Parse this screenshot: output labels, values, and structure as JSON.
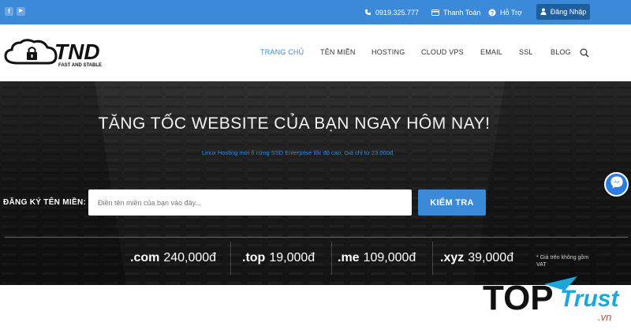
{
  "topbar": {
    "social": [
      {
        "name": "facebook-icon",
        "glyph": "f"
      },
      {
        "name": "youtube-icon",
        "glyph": "▶"
      }
    ],
    "phone": "0919.325.777",
    "payment": "Thanh Toán",
    "support": "Hỗ Trợ",
    "login": "Đăng Nhập"
  },
  "logo": {
    "brand": "TND",
    "tagline": "FAST AND STABLE"
  },
  "nav": {
    "items": [
      "TRANG CHỦ",
      "TÊN MIỀN",
      "HOSTING",
      "CLOUD VPS",
      "EMAIL",
      "SSL",
      "BLOG"
    ],
    "active": "TRANG CHỦ"
  },
  "hero": {
    "title": "TĂNG TỐC WEBSITE CỦA BẠN NGAY HÔM NAY!",
    "subtitle": "Linux Hosting mới ổ cứng SSD Enterprise tốc độ cao, Giá chỉ từ 23.000đ.",
    "register_label": "ĐĂNG KÝ TÊN MIỀN:",
    "input_placeholder": "Điền tên miền của bạn vào đây...",
    "check_button": "KIỂM TRA"
  },
  "prices": [
    {
      "tld": ".com",
      "price": "240,000đ"
    },
    {
      "tld": ".top",
      "price": "19,000đ"
    },
    {
      "tld": ".me",
      "price": "109,000đ"
    },
    {
      "tld": ".xyz",
      "price": "39,000đ"
    }
  ],
  "vat_note": "* Giá trên không gồm VAT",
  "watermark": {
    "top": "TOP",
    "trust": "Trust",
    "domain": ".vn"
  },
  "colors": {
    "primary": "#3b8ad9",
    "dark_blue": "#1f5f9e",
    "messenger": "#2a7de1"
  }
}
